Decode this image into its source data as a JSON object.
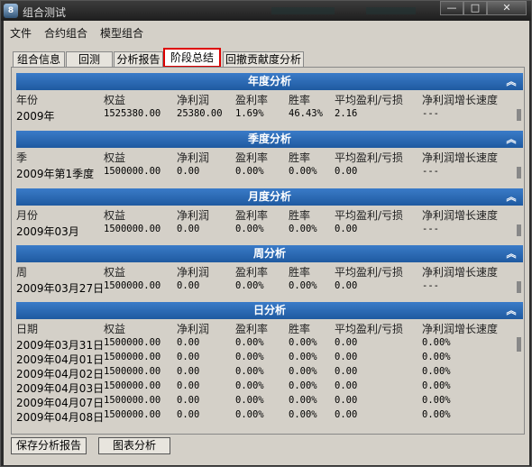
{
  "window": {
    "title": "组合测试",
    "app_icon_text": "8",
    "min": "—",
    "max": "□",
    "close": "✕"
  },
  "menu": [
    "文件",
    "合约组合",
    "模型组合"
  ],
  "tabs": [
    {
      "label": "组合信息",
      "active": false
    },
    {
      "label": "回测",
      "active": false
    },
    {
      "label": "分析报告",
      "active": false
    },
    {
      "label": "阶段总结",
      "active": true
    },
    {
      "label": "回撤贡献度分析",
      "active": false
    }
  ],
  "columns": [
    "权益",
    "净利润",
    "盈利率",
    "胜率",
    "平均盈利/亏损",
    "净利润增长速度"
  ],
  "collapse_glyph": "︽",
  "sections": {
    "year": {
      "title": "年度分析",
      "period_col": "年份",
      "rows": [
        [
          "2009年",
          "1525380.00",
          "25380.00",
          "1.69%",
          "46.43%",
          "2.16",
          "---"
        ]
      ]
    },
    "quarter": {
      "title": "季度分析",
      "period_col": "季",
      "rows": [
        [
          "2009年第1季度",
          "1500000.00",
          "0.00",
          "0.00%",
          "0.00%",
          "0.00",
          "---"
        ]
      ]
    },
    "month": {
      "title": "月度分析",
      "period_col": "月份",
      "rows": [
        [
          "2009年03月",
          "1500000.00",
          "0.00",
          "0.00%",
          "0.00%",
          "0.00",
          "---"
        ]
      ]
    },
    "week": {
      "title": "周分析",
      "period_col": "周",
      "rows": [
        [
          "2009年03月27日",
          "1500000.00",
          "0.00",
          "0.00%",
          "0.00%",
          "0.00",
          "---"
        ]
      ]
    },
    "day": {
      "title": "日分析",
      "period_col": "日期",
      "rows": [
        [
          "2009年03月31日",
          "1500000.00",
          "0.00",
          "0.00%",
          "0.00%",
          "0.00",
          "0.00%"
        ],
        [
          "2009年04月01日",
          "1500000.00",
          "0.00",
          "0.00%",
          "0.00%",
          "0.00",
          "0.00%"
        ],
        [
          "2009年04月02日",
          "1500000.00",
          "0.00",
          "0.00%",
          "0.00%",
          "0.00",
          "0.00%"
        ],
        [
          "2009年04月03日",
          "1500000.00",
          "0.00",
          "0.00%",
          "0.00%",
          "0.00",
          "0.00%"
        ],
        [
          "2009年04月07日",
          "1500000.00",
          "0.00",
          "0.00%",
          "0.00%",
          "0.00",
          "0.00%"
        ],
        [
          "2009年04月08日",
          "1500000.00",
          "0.00",
          "0.00%",
          "0.00%",
          "0.00",
          "0.00%"
        ]
      ]
    }
  },
  "footer": {
    "save_report": "保存分析报告",
    "chart_analysis": "图表分析"
  }
}
